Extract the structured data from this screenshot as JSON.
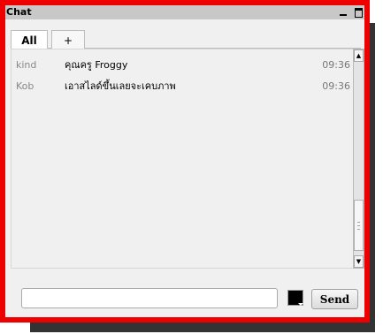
{
  "window": {
    "title": "Chat",
    "minimize_icon": "minimize-icon",
    "maximize_icon": "maximize-icon",
    "border_color": "#ee0000"
  },
  "tabs": [
    {
      "label": "All",
      "active": true
    },
    {
      "label": "+",
      "active": false
    }
  ],
  "messages": [
    {
      "user": "kind",
      "text": "คุณครู Froggy",
      "time": "09:36"
    },
    {
      "user": "Kob",
      "text": "เอาสไลด์ขึ้นเลยจะเคบภาพ",
      "time": "09:36"
    }
  ],
  "scrollbar": {
    "up_icon": "▲",
    "down_icon": "▼"
  },
  "composer": {
    "input_value": "",
    "input_placeholder": "",
    "text_color": "#000000",
    "send_label": "Send"
  }
}
